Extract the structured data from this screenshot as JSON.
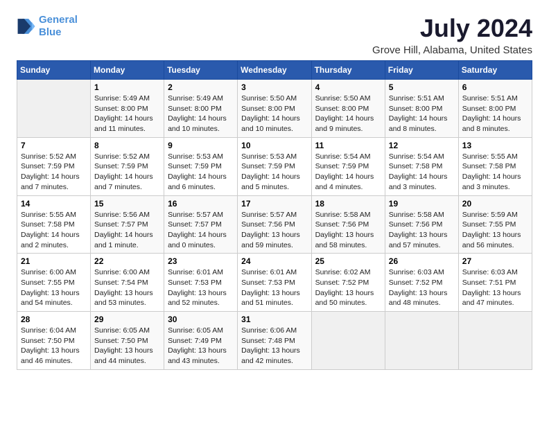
{
  "logo": {
    "line1": "General",
    "line2": "Blue"
  },
  "title": "July 2024",
  "subtitle": "Grove Hill, Alabama, United States",
  "days_header": [
    "Sunday",
    "Monday",
    "Tuesday",
    "Wednesday",
    "Thursday",
    "Friday",
    "Saturday"
  ],
  "weeks": [
    [
      {
        "day": "",
        "info": ""
      },
      {
        "day": "1",
        "info": "Sunrise: 5:49 AM\nSunset: 8:00 PM\nDaylight: 14 hours\nand 11 minutes."
      },
      {
        "day": "2",
        "info": "Sunrise: 5:49 AM\nSunset: 8:00 PM\nDaylight: 14 hours\nand 10 minutes."
      },
      {
        "day": "3",
        "info": "Sunrise: 5:50 AM\nSunset: 8:00 PM\nDaylight: 14 hours\nand 10 minutes."
      },
      {
        "day": "4",
        "info": "Sunrise: 5:50 AM\nSunset: 8:00 PM\nDaylight: 14 hours\nand 9 minutes."
      },
      {
        "day": "5",
        "info": "Sunrise: 5:51 AM\nSunset: 8:00 PM\nDaylight: 14 hours\nand 8 minutes."
      },
      {
        "day": "6",
        "info": "Sunrise: 5:51 AM\nSunset: 8:00 PM\nDaylight: 14 hours\nand 8 minutes."
      }
    ],
    [
      {
        "day": "7",
        "info": "Sunrise: 5:52 AM\nSunset: 7:59 PM\nDaylight: 14 hours\nand 7 minutes."
      },
      {
        "day": "8",
        "info": "Sunrise: 5:52 AM\nSunset: 7:59 PM\nDaylight: 14 hours\nand 7 minutes."
      },
      {
        "day": "9",
        "info": "Sunrise: 5:53 AM\nSunset: 7:59 PM\nDaylight: 14 hours\nand 6 minutes."
      },
      {
        "day": "10",
        "info": "Sunrise: 5:53 AM\nSunset: 7:59 PM\nDaylight: 14 hours\nand 5 minutes."
      },
      {
        "day": "11",
        "info": "Sunrise: 5:54 AM\nSunset: 7:59 PM\nDaylight: 14 hours\nand 4 minutes."
      },
      {
        "day": "12",
        "info": "Sunrise: 5:54 AM\nSunset: 7:58 PM\nDaylight: 14 hours\nand 3 minutes."
      },
      {
        "day": "13",
        "info": "Sunrise: 5:55 AM\nSunset: 7:58 PM\nDaylight: 14 hours\nand 3 minutes."
      }
    ],
    [
      {
        "day": "14",
        "info": "Sunrise: 5:55 AM\nSunset: 7:58 PM\nDaylight: 14 hours\nand 2 minutes."
      },
      {
        "day": "15",
        "info": "Sunrise: 5:56 AM\nSunset: 7:57 PM\nDaylight: 14 hours\nand 1 minute."
      },
      {
        "day": "16",
        "info": "Sunrise: 5:57 AM\nSunset: 7:57 PM\nDaylight: 14 hours\nand 0 minutes."
      },
      {
        "day": "17",
        "info": "Sunrise: 5:57 AM\nSunset: 7:56 PM\nDaylight: 13 hours\nand 59 minutes."
      },
      {
        "day": "18",
        "info": "Sunrise: 5:58 AM\nSunset: 7:56 PM\nDaylight: 13 hours\nand 58 minutes."
      },
      {
        "day": "19",
        "info": "Sunrise: 5:58 AM\nSunset: 7:56 PM\nDaylight: 13 hours\nand 57 minutes."
      },
      {
        "day": "20",
        "info": "Sunrise: 5:59 AM\nSunset: 7:55 PM\nDaylight: 13 hours\nand 56 minutes."
      }
    ],
    [
      {
        "day": "21",
        "info": "Sunrise: 6:00 AM\nSunset: 7:55 PM\nDaylight: 13 hours\nand 54 minutes."
      },
      {
        "day": "22",
        "info": "Sunrise: 6:00 AM\nSunset: 7:54 PM\nDaylight: 13 hours\nand 53 minutes."
      },
      {
        "day": "23",
        "info": "Sunrise: 6:01 AM\nSunset: 7:53 PM\nDaylight: 13 hours\nand 52 minutes."
      },
      {
        "day": "24",
        "info": "Sunrise: 6:01 AM\nSunset: 7:53 PM\nDaylight: 13 hours\nand 51 minutes."
      },
      {
        "day": "25",
        "info": "Sunrise: 6:02 AM\nSunset: 7:52 PM\nDaylight: 13 hours\nand 50 minutes."
      },
      {
        "day": "26",
        "info": "Sunrise: 6:03 AM\nSunset: 7:52 PM\nDaylight: 13 hours\nand 48 minutes."
      },
      {
        "day": "27",
        "info": "Sunrise: 6:03 AM\nSunset: 7:51 PM\nDaylight: 13 hours\nand 47 minutes."
      }
    ],
    [
      {
        "day": "28",
        "info": "Sunrise: 6:04 AM\nSunset: 7:50 PM\nDaylight: 13 hours\nand 46 minutes."
      },
      {
        "day": "29",
        "info": "Sunrise: 6:05 AM\nSunset: 7:50 PM\nDaylight: 13 hours\nand 44 minutes."
      },
      {
        "day": "30",
        "info": "Sunrise: 6:05 AM\nSunset: 7:49 PM\nDaylight: 13 hours\nand 43 minutes."
      },
      {
        "day": "31",
        "info": "Sunrise: 6:06 AM\nSunset: 7:48 PM\nDaylight: 13 hours\nand 42 minutes."
      },
      {
        "day": "",
        "info": ""
      },
      {
        "day": "",
        "info": ""
      },
      {
        "day": "",
        "info": ""
      }
    ]
  ]
}
